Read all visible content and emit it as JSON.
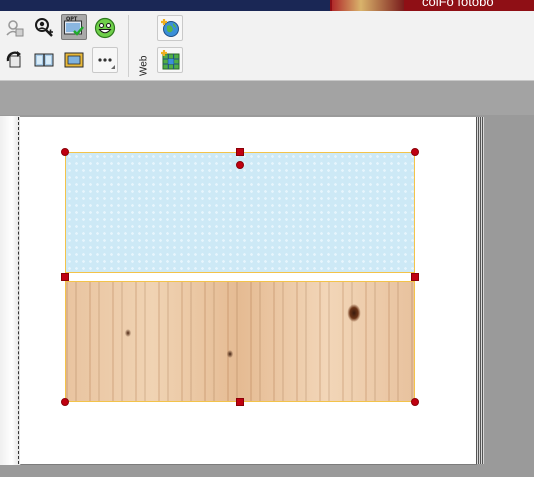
{
  "app": {
    "brand_text": "colFo fotobo",
    "brand_color": "#8f0f15",
    "titlebar_color": "#1a2755"
  },
  "toolbar": {
    "row1": [
      {
        "name": "hide-selection",
        "icon": "person-hidden-icon",
        "enabled": false
      },
      {
        "name": "find-person",
        "icon": "person-search-icon",
        "enabled": true
      },
      {
        "name": "optimize-photo",
        "icon": "opt-check-icon",
        "enabled": true,
        "selected": true,
        "text": "OPT"
      },
      {
        "name": "smiley",
        "icon": "smiley-icon",
        "enabled": true
      }
    ],
    "row2": [
      {
        "name": "rotate",
        "icon": "rotate-icon",
        "enabled": true
      },
      {
        "name": "split-frame",
        "icon": "split-frame-icon",
        "enabled": true
      },
      {
        "name": "frame",
        "icon": "picture-frame-icon",
        "enabled": true
      },
      {
        "name": "more",
        "icon": "more-icon",
        "enabled": true
      }
    ],
    "web_label": "Web",
    "web_buttons": [
      {
        "name": "web-globe-add",
        "icon": "globe-add-icon"
      },
      {
        "name": "web-grid-add",
        "icon": "grid-add-icon"
      }
    ]
  },
  "canvas": {
    "page_color": "#ffffff",
    "workspace_color": "#9a9a9a",
    "selection_color": "#f3c34a",
    "handle_color": "#c00010",
    "frames": [
      {
        "name": "pattern-photo-frame",
        "content": "blue dotted pattern"
      },
      {
        "name": "wood-photo-frame",
        "content": "wood texture"
      }
    ]
  }
}
